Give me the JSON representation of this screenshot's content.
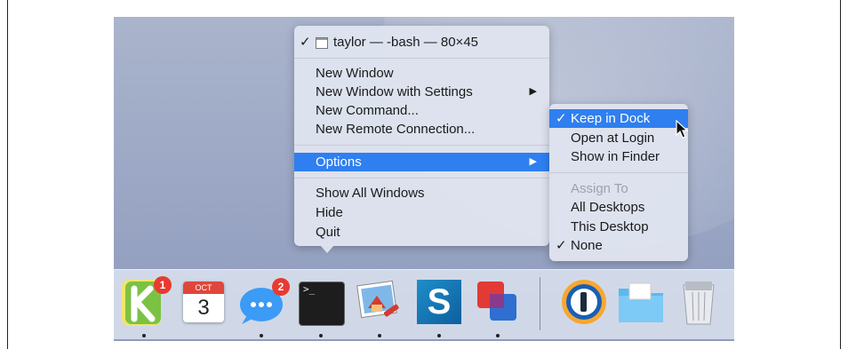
{
  "menu": {
    "title": "taylor — -bash — 80×45",
    "items": [
      {
        "label": "New Window"
      },
      {
        "label": "New Window with Settings",
        "submenu": true
      },
      {
        "label": "New Command..."
      },
      {
        "label": "New Remote Connection..."
      },
      {
        "label": "Options",
        "submenu": true,
        "highlighted": true
      },
      {
        "label": "Show All Windows"
      },
      {
        "label": "Hide"
      },
      {
        "label": "Quit"
      }
    ]
  },
  "submenu": {
    "items": [
      {
        "label": "Keep in Dock",
        "checked": true,
        "highlighted": true
      },
      {
        "label": "Open at Login"
      },
      {
        "label": "Show in Finder"
      },
      {
        "label": "Assign To",
        "disabled": true
      },
      {
        "label": "All Desktops"
      },
      {
        "label": "This Desktop"
      },
      {
        "label": "None",
        "checked": true
      }
    ]
  },
  "dock": {
    "items": [
      {
        "name": "kiwi-app-icon",
        "badge": "1",
        "running": true
      },
      {
        "name": "calendar-icon",
        "month": "OCT",
        "day": "3",
        "running": false
      },
      {
        "name": "messages-icon",
        "badge": "2",
        "running": true
      },
      {
        "name": "terminal-icon",
        "prompt": ">_",
        "running": true
      },
      {
        "name": "preview-icon",
        "running": true
      },
      {
        "name": "snagit-icon",
        "letter": "S",
        "running": true
      },
      {
        "name": "parallels-icon",
        "running": true
      },
      {
        "name": "1password-icon",
        "running": false
      },
      {
        "name": "downloads-folder-icon",
        "running": false
      },
      {
        "name": "trash-icon",
        "running": false
      }
    ]
  },
  "glyphs": {
    "check": "✓",
    "arrow": "▶"
  },
  "colors": {
    "highlight": "#2f7ff0",
    "badge": "#e83a30"
  }
}
